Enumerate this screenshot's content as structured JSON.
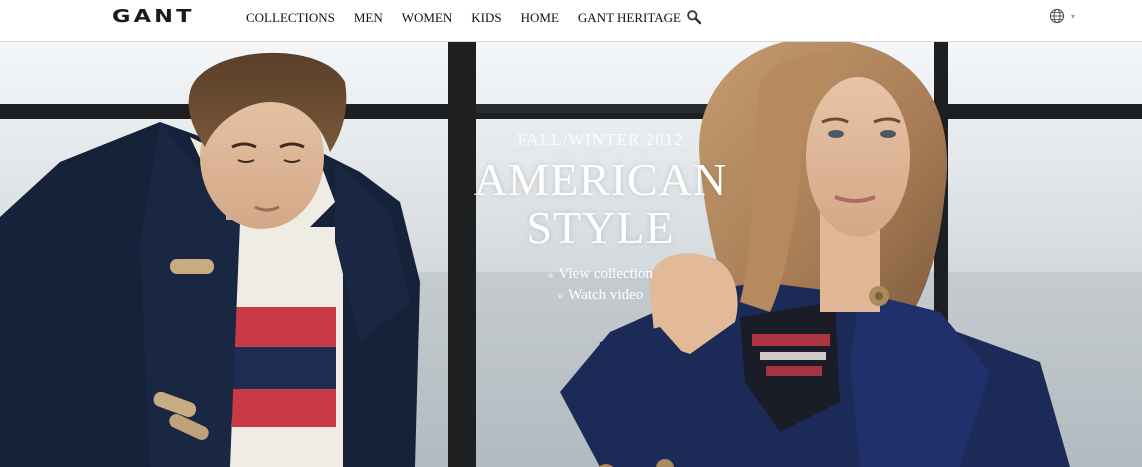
{
  "brand": {
    "logo": "GANT"
  },
  "nav": {
    "items": [
      "COLLECTIONS",
      "MEN",
      "WOMEN",
      "KIDS",
      "HOME",
      "GANT HERITAGE"
    ],
    "search_icon": "search-icon"
  },
  "language": {
    "icon": "globe-icon",
    "caret": "▾"
  },
  "hero": {
    "kicker": "FALL/WINTER 2012",
    "headline_line1": "AMERICAN",
    "headline_line2": "STYLE",
    "links": [
      {
        "label": "View collection",
        "marker": "»"
      },
      {
        "label": "Watch video",
        "marker": "»"
      }
    ]
  },
  "colors": {
    "navy": "#16223a",
    "sweater_red": "#c83a46",
    "sweater_cream": "#efece4",
    "window_frame": "#1e1f21",
    "header_bg": "#ffffff"
  }
}
